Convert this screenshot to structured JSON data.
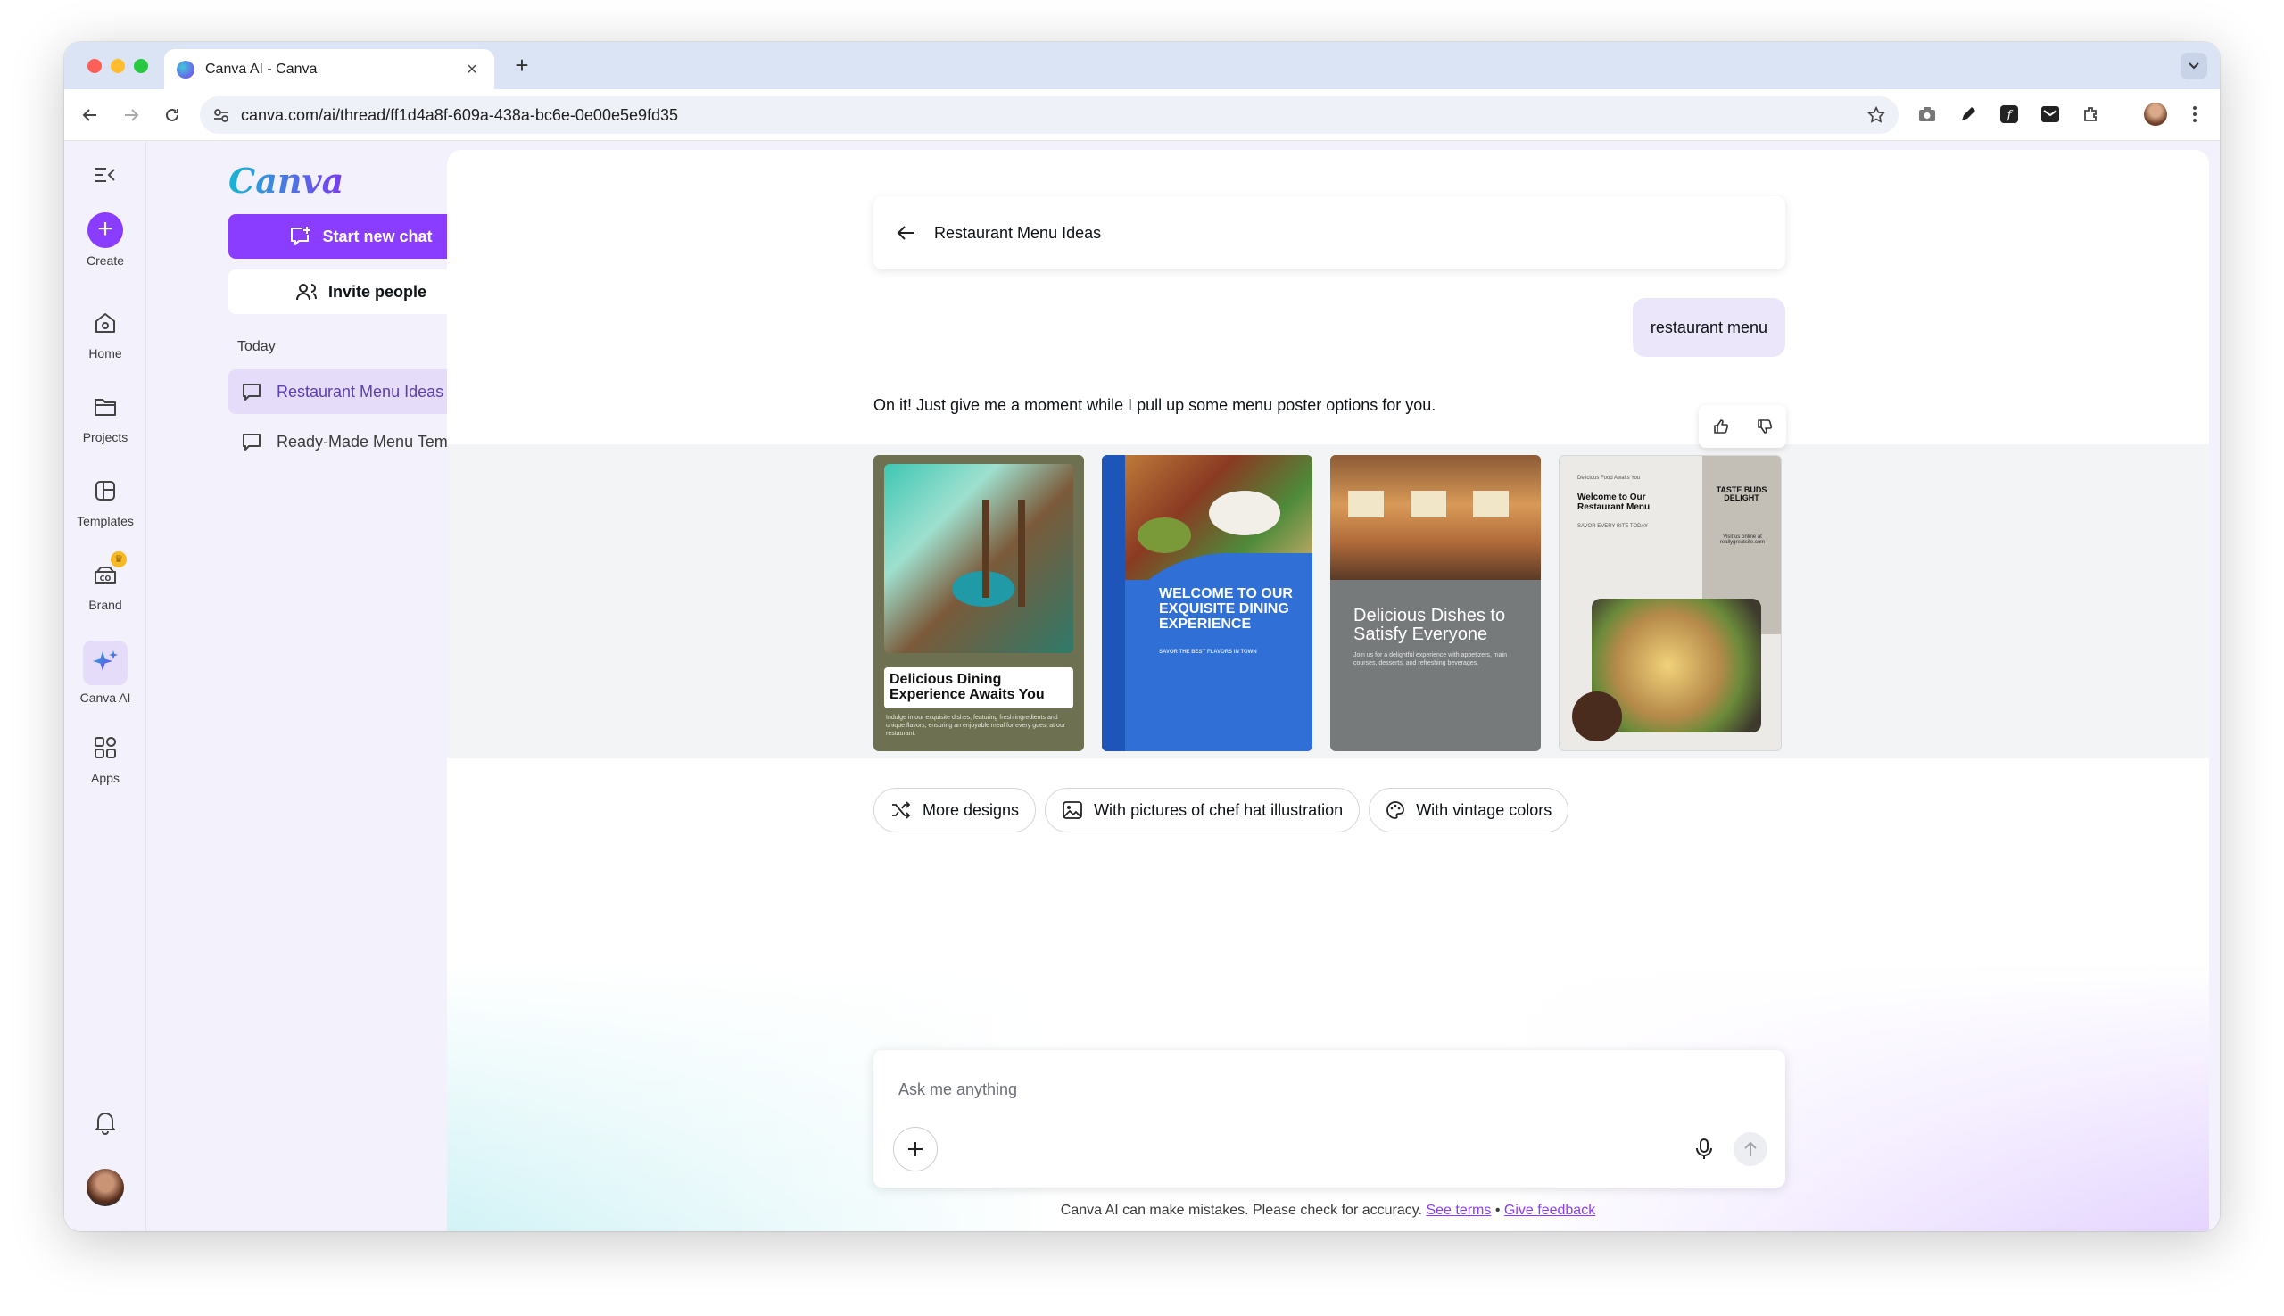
{
  "browser": {
    "tab_title": "Canva AI - Canva",
    "url": "canva.com/ai/thread/ff1d4a8f-609a-438a-bc6e-0e00e5e9fd35"
  },
  "rail": {
    "items": [
      {
        "label": "Create"
      },
      {
        "label": "Home"
      },
      {
        "label": "Projects"
      },
      {
        "label": "Templates"
      },
      {
        "label": "Brand"
      },
      {
        "label": "Canva AI"
      },
      {
        "label": "Apps"
      }
    ]
  },
  "sidebar": {
    "logo": "Canva",
    "start_new_chat": "Start new chat",
    "invite_people": "Invite people",
    "section_today": "Today",
    "chats": [
      {
        "label": "Restaurant Menu Ideas"
      },
      {
        "label": "Ready-Made Menu Tem..."
      }
    ]
  },
  "thread": {
    "title": "Restaurant Menu Ideas",
    "user_message": "restaurant menu",
    "ai_message": "On it! Just give me a moment while I pull up some menu poster options for you."
  },
  "designs": [
    {
      "title": "Delicious Dining Experience Awaits You",
      "body": "Indulge in our exquisite dishes, featuring fresh ingredients and unique flavors, ensuring an enjoyable meal for every guest at our restaurant."
    },
    {
      "title": "WELCOME TO OUR EXQUISITE DINING EXPERIENCE",
      "subtitle": "SAVOR THE BEST FLAVORS IN TOWN"
    },
    {
      "title": "Delicious Dishes to Satisfy Everyone",
      "body": "Join us for a delightful experience with appetizers, main courses, desserts, and refreshing beverages."
    },
    {
      "kicker": "Delicious Food Awaits You",
      "title": "Welcome to Our Restaurant Menu",
      "subtitle": "SAVOR EVERY BITE TODAY",
      "side_title": "TASTE BUDS DELIGHT",
      "side_text": "Visit us online at reallygreatsite.com"
    }
  ],
  "suggestions": [
    {
      "label": "More designs",
      "icon": "shuffle-icon"
    },
    {
      "label": "With pictures of chef hat illustration",
      "icon": "image-icon"
    },
    {
      "label": "With vintage colors",
      "icon": "palette-icon"
    }
  ],
  "composer": {
    "placeholder": "Ask me anything"
  },
  "footer": {
    "disclaimer": "Canva AI can make mistakes. Please check for accuracy.",
    "see_terms": "See terms",
    "separator": "•",
    "give_feedback": "Give feedback"
  },
  "colors": {
    "accent": "#8b3dff",
    "rail_bg": "#f3f1fb",
    "active_chat_bg": "#e5dcfa",
    "user_bubble_bg": "#ece6fb"
  }
}
